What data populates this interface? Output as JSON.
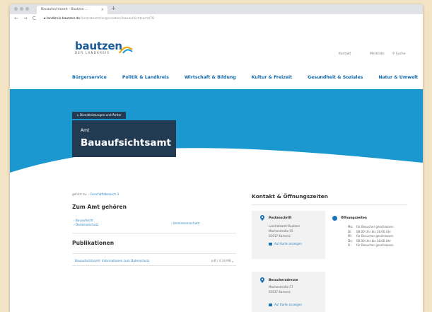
{
  "browser": {
    "tab_title": "Bauaufsichtsamt - Bautzen ...",
    "tab_close": "×",
    "new_tab": "+",
    "nav": {
      "back": "←",
      "forward": "→",
      "reload": "C"
    },
    "url_host": "landkreis-bautzen.de",
    "url_path": "/landratsamt/organisation/bauaufsichtsamt/78"
  },
  "header": {
    "logo_main": "bautzen",
    "logo_sub": "DER LANDKREIS",
    "util": {
      "kontakt": "Kontakt",
      "merkliste": "Merkliste",
      "suche": "Suche"
    }
  },
  "nav": [
    "Bürgerservice",
    "Politik & Landkreis",
    "Wirtschaft & Bildung",
    "Kultur & Freizeit",
    "Gesundheit & Soziales",
    "Natur & Umwelt"
  ],
  "hero": {
    "breadcrumb": "Dienstleistungen und Ämter",
    "title_pre": "Amt",
    "title": "Bauaufsichtsamt"
  },
  "amt": {
    "gehoert_label": "gehört zu:",
    "gehoert_link": "Geschäftsbereich 3",
    "zum_amt_heading": "Zum Amt gehören",
    "links_left": [
      "Bauaufsicht",
      "Denkmalschutz"
    ],
    "links_right": [
      "Immissionsschutz"
    ],
    "publikationen_heading": "Publikationen",
    "publikation_title": "Bauaufsichtsamt: Informationen zum Datenschutz",
    "publikation_meta": "pdf | 0,18 MB"
  },
  "kontakt": {
    "heading": "Kontakt & Öffnungszeiten",
    "postanschrift": {
      "title": "Postanschrift",
      "lines": [
        "Landratsamt Bautzen",
        "Macherstraße 55",
        "01917 Kamenz"
      ],
      "map_link": "Auf Karte anzeigen"
    },
    "besucher": {
      "title": "Besucheradresse",
      "lines": [
        "Macherstraße 57",
        "01917 Kamenz"
      ],
      "map_link": "Auf Karte anzeigen"
    },
    "oeffnungszeiten": {
      "title": "Öffnungszeiten",
      "rows": [
        {
          "day": "Mo:",
          "text": "für Besucher geschlossen"
        },
        {
          "day": "Di:",
          "text": "08.00 Uhr bis 18.00 Uhr"
        },
        {
          "day": "Mi:",
          "text": "für Besucher geschlossen"
        },
        {
          "day": "Do:",
          "text": "08.00 Uhr bis 18.00 Uhr"
        },
        {
          "day": "Fr:",
          "text": "für Besucher geschlossen"
        }
      ]
    }
  },
  "colors": {
    "brand_blue": "#1a5a96",
    "hero_blue": "#1a98cf",
    "title_box": "#223b52",
    "link_blue": "#2b83c1",
    "backdrop": "#f4e4c6"
  }
}
